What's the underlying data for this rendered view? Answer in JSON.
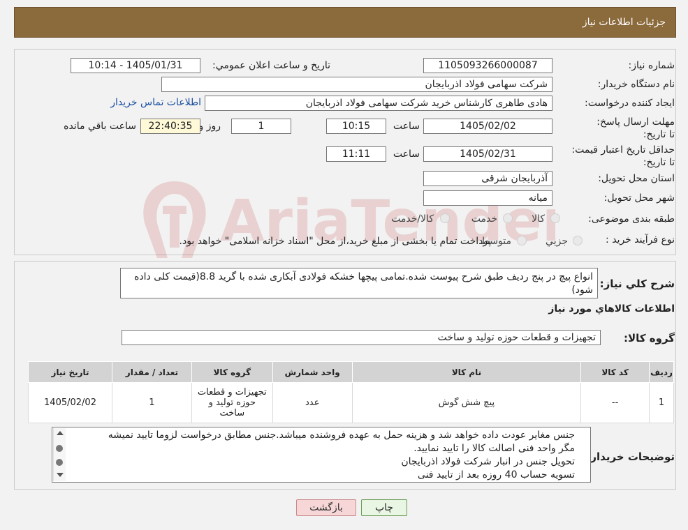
{
  "header": {
    "title": "جزئیات اطلاعات نیاز"
  },
  "form": {
    "need_number_label": "شماره نیاز:",
    "need_number": "1105093266000087",
    "announce_label": "تاریخ و ساعت اعلان عمومي:",
    "announce_value": "1405/01/31 - 10:14",
    "buyer_org_label": "نام دستگاه خریدار:",
    "buyer_org": "شرکت سهامی فولاد اذربایجان",
    "requester_label": "ایجاد کننده درخواست:",
    "requester": "هادی طاهری کارشناس خرید شرکت سهامی فولاد اذربایجان",
    "contact_link": "اطلاعات تماس خریدار",
    "reply_deadline_label": "مهلت ارسال پاسخ: تا تاریخ:",
    "reply_date": "1405/02/02",
    "time_label": "ساعت",
    "reply_time": "10:15",
    "days_value": "1",
    "days_label": "روز و",
    "remaining_time": "22:40:35",
    "remaining_label": "ساعت باقي مانده",
    "price_validity_label": "حداقل تاریخ اعتبار قیمت: تا تاریخ:",
    "price_date": "1405/02/31",
    "price_time": "11:11",
    "province_label": "استان محل تحویل:",
    "province": "آذربایجان شرقی",
    "city_label": "شهر محل تحویل:",
    "city": "میانه",
    "category_label": "طبقه بندی موضوعی:",
    "category_options": [
      "کالا",
      "خدمت",
      "کالا/خدمت"
    ],
    "process_label": "نوع فرآیند خرید :",
    "process_options": [
      "جزیي",
      "متوسط"
    ],
    "process_note": "پرداخت تمام یا بخشی از مبلغ خرید،از محل \"اسناد خزانه اسلامی\" خواهد بود."
  },
  "watermark": {
    "text": "AriaTender.neT"
  },
  "details": {
    "summary_label": "شرح کلي نياز:",
    "summary": "انواع پیچ در پنج ردیف طبق شرح پیوست شده.تمامی پیچها خشکه فولادی آبکاری شده با گرید 8.8(قیمت کلی داده شود)",
    "goods_info_title": "اطلاعات کالاهاي مورد نياز",
    "goods_group_label": "گروه کالا:",
    "goods_group": "تجهیزات و قطعات حوزه تولید و ساخت"
  },
  "table": {
    "headers": [
      "رديف",
      "کد کالا",
      "نام کالا",
      "واحد شمارش",
      "گروه کالا",
      "تعداد / مقدار",
      "تاريخ نياز"
    ],
    "rows": [
      [
        "1",
        "--",
        "پیچ شش گوش",
        "عدد",
        "تجهیزات و قطعات حوزه تولید و ساخت",
        "1",
        "1405/02/02"
      ]
    ]
  },
  "notes": {
    "label": "توضيحات خريدار:",
    "lines": [
      "جنس مغایر عودت داده خواهد شد و هزینه حمل به عهده فروشنده میباشد.جنس مطابق درخواست لزوما تایید نمیشه",
      "مگر واحد فنی اصالت کالا را تایید نمایید.",
      "تحویل جنس در انبار شرکت فولاد اذربایجان",
      "تسویه حساب 40 روزه بعد از تایید فنی"
    ]
  },
  "buttons": {
    "print": "چاپ",
    "back": "بازگشت"
  }
}
